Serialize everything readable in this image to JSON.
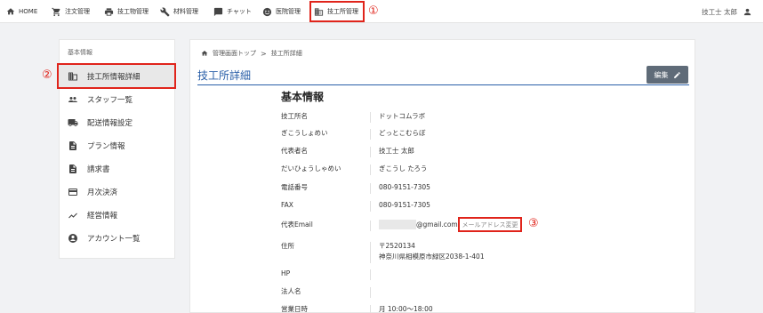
{
  "nav": {
    "home": "HOME",
    "orders": "注文管理",
    "tech_items": "技工物管理",
    "materials": "材料管理",
    "chat": "チャット",
    "clinics": "医院管理",
    "labs": "技工所管理",
    "marker1": "①"
  },
  "user": {
    "name": "技工士 太郎"
  },
  "sidebar": {
    "heading": "基本情報",
    "marker2": "②",
    "items": [
      {
        "label": "技工所情報詳細",
        "icon": "building-icon"
      },
      {
        "label": "スタッフ一覧",
        "icon": "people-icon"
      },
      {
        "label": "配送情報設定",
        "icon": "truck-icon"
      },
      {
        "label": "プラン情報",
        "icon": "document-icon"
      },
      {
        "label": "請求書",
        "icon": "invoice-icon"
      },
      {
        "label": "月次決済",
        "icon": "card-icon"
      },
      {
        "label": "経営情報",
        "icon": "trend-icon"
      },
      {
        "label": "アカウント一覧",
        "icon": "account-icon"
      }
    ]
  },
  "breadcrumb": {
    "home": "管理画面トップ",
    "sep": ">",
    "current": "技工所詳細"
  },
  "page": {
    "title": "技工所詳細",
    "edit_label": "編集"
  },
  "info": {
    "section_title": "基本情報",
    "marker3": "③",
    "email_change": "メールアドレス変更",
    "rows": [
      {
        "label": "技工所名",
        "value": "ドットコムラボ"
      },
      {
        "label": "ぎこうしょめい",
        "value": "どっとこむらぼ"
      },
      {
        "label": "代表者名",
        "value": "技工士 太郎"
      },
      {
        "label": "だいひょうしゃめい",
        "value": "ぎこうし たろう"
      },
      {
        "label": "電話番号",
        "value": "080-9151-7305"
      },
      {
        "label": "FAX",
        "value": "080-9151-7305"
      },
      {
        "label": "代表Email",
        "value": "@gmail.com"
      },
      {
        "label": "住所",
        "value": "〒2520134",
        "value2": "神奈川県相模原市緑区2038-1-401"
      },
      {
        "label": "HP",
        "value": ""
      },
      {
        "label": "法人名",
        "value": ""
      },
      {
        "label": "営業日時",
        "value": "月 10:00〜18:00"
      }
    ]
  },
  "colors": {
    "accent": "#2a5fa8",
    "highlight": "#e0241b",
    "button": "#5f6b78"
  }
}
